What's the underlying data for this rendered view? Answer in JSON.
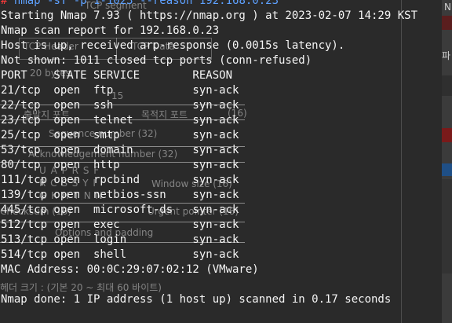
{
  "terminal": {
    "prompt": {
      "symbol": "#",
      "command": "nmap -sT -p 1-1023 --reason 192.168.0.23"
    },
    "lines": [
      "Starting Nmap 7.93 ( https://nmap.org ) at 2023-02-07 14:29 KST",
      "Nmap scan report for 192.168.0.23",
      "Host is up, received arp-response (0.0015s latency).",
      "Not shown: 1011 closed tcp ports (conn-refused)",
      "PORT    STATE SERVICE        REASON",
      "21/tcp  open  ftp            syn-ack",
      "22/tcp  open  ssh            syn-ack",
      "23/tcp  open  telnet         syn-ack",
      "25/tcp  open  smtp           syn-ack",
      "53/tcp  open  domain         syn-ack",
      "80/tcp  open  http           syn-ack",
      "111/tcp open  rpcbind        syn-ack",
      "139/tcp open  netbios-ssn    syn-ack",
      "445/tcp open  microsoft-ds   syn-ack",
      "512/tcp open  exec           syn-ack",
      "513/tcp open  login          syn-ack",
      "514/tcp open  shell          syn-ack",
      "MAC Address: 00:0C:29:07:02:12 (VMware)",
      "",
      "Nmap done: 1 IP address (1 host up) scanned in 0.17 seconds"
    ]
  },
  "background_diagram": {
    "tcp_segment": "TCP segment",
    "tcp_header": "TCP Header",
    "tcp_data": "TCP Data",
    "bytes_20": "20 bytes",
    "bits_15": "15",
    "src_port": "출발지 포트",
    "dst_port": "목적지 포트",
    "dst_port_bits": "(16)",
    "sequence_number": "Sequence number (32)",
    "ack_number": "Acknowledgement number (32)",
    "flags_row1": "U A P R S F",
    "flags_row2": "R C S S Y I",
    "flags_row3": "G K H T N N",
    "window_size": "Window size (16)",
    "checksum": "Checksum (16)",
    "urgent_pointer": "Urgent pointer (16)",
    "options_padding": "Options and padding",
    "header_size_note": "헤더 크기 : (기본 20 ~ 최대 60 바이트)"
  },
  "right_panel": {
    "char_top": "N",
    "char_mid": "파"
  },
  "colors": {
    "terminal_bg": "#2a2a2a",
    "prompt_hash": "#ff3b3b",
    "prompt_command": "#5ea1ff",
    "text": "#f5f5f5"
  }
}
